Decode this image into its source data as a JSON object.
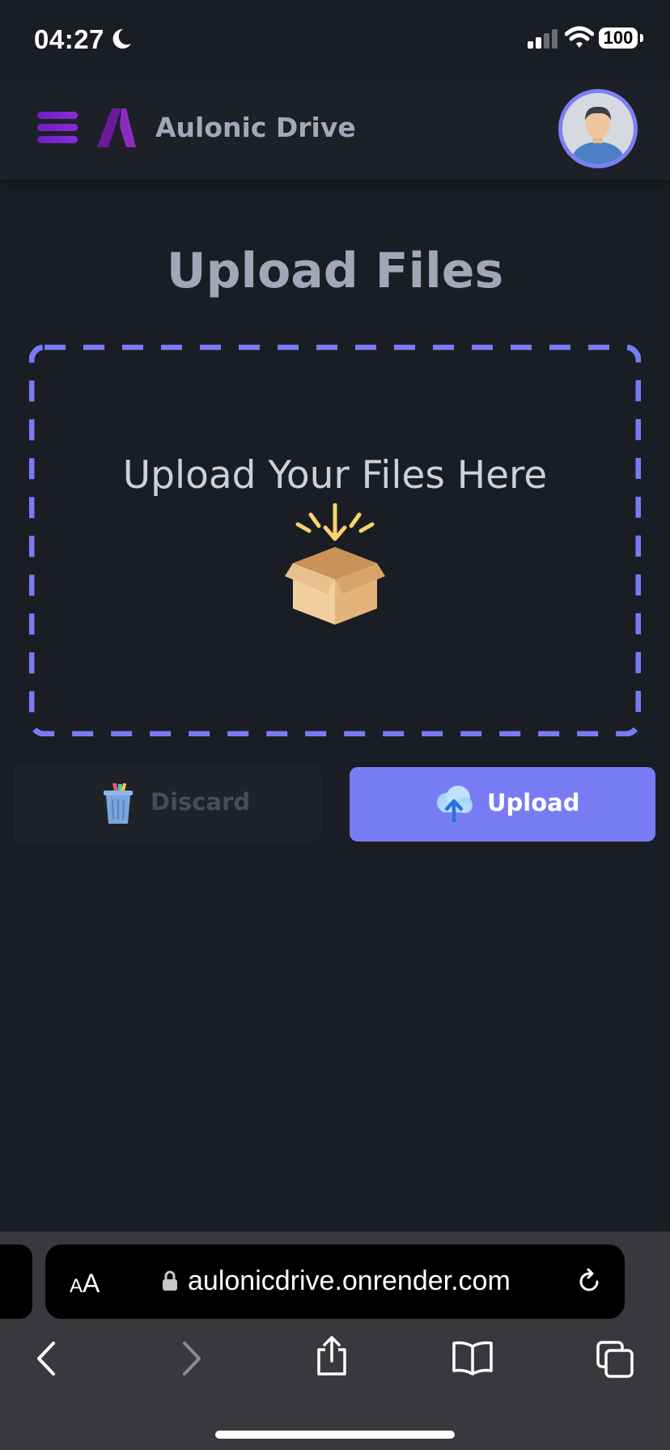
{
  "status_bar": {
    "time": "04:27",
    "battery": "100"
  },
  "header": {
    "brand_name": "Aulonic Drive"
  },
  "main": {
    "title": "Upload Files",
    "dropzone_label": "Upload Your Files Here"
  },
  "actions": {
    "discard_label": "Discard",
    "upload_label": "Upload"
  },
  "browser": {
    "aa_small": "A",
    "aa_big": "A",
    "url": "aulonicdrive.onrender.com"
  },
  "colors": {
    "accent": "#787cf4",
    "background": "#1b1d24",
    "header": "#1d2027",
    "menu_gradient": "#7a24cc"
  },
  "icons": {
    "menu": "hamburger-icon",
    "logo": "brand-logo",
    "avatar": "user-avatar",
    "dropzone": "open-box-icon",
    "discard": "trash-icon",
    "upload": "cloud-upload-icon",
    "browser_nav": [
      "back-icon",
      "forward-icon",
      "share-icon",
      "bookmarks-icon",
      "tabs-icon"
    ]
  }
}
